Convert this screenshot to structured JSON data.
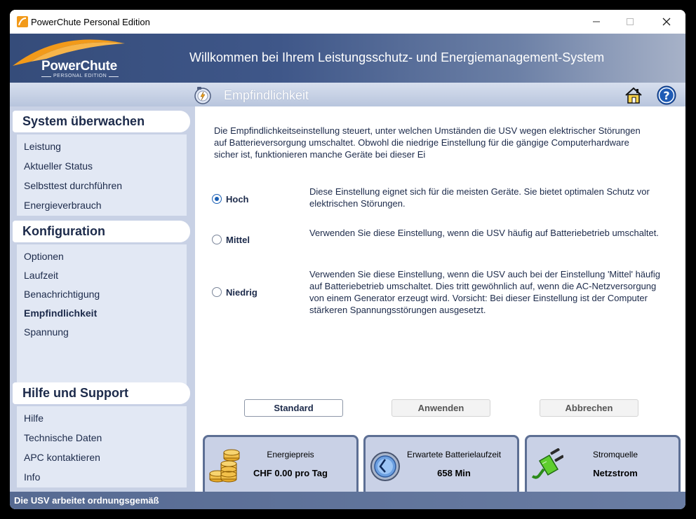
{
  "window": {
    "title": "PowerChute Personal Edition",
    "min_icon": "minimize-icon",
    "max_icon": "maximize-icon",
    "close_icon": "close-icon"
  },
  "header": {
    "logo_name": "PowerChute",
    "logo_sub": "PERSONAL EDITION",
    "title": "Willkommen bei Ihrem Leistungsschutz- und Energiemanagement-System"
  },
  "subheader": {
    "title": "Empfindlichkeit"
  },
  "sidebar": {
    "sections": [
      {
        "title": "System überwachen",
        "items": [
          "Leistung",
          "Aktueller Status",
          "Selbsttest durchführen",
          "Energieverbrauch"
        ]
      },
      {
        "title": "Konfiguration",
        "items": [
          "Optionen",
          "Laufzeit",
          "Benachrichtigung",
          "Empfindlichkeit",
          "Spannung"
        ]
      },
      {
        "title": "Hilfe und Support",
        "items": [
          "Hilfe",
          "Technische Daten",
          "APC kontaktieren",
          "Info"
        ]
      }
    ],
    "active_item": "Empfindlichkeit"
  },
  "content": {
    "intro": "Die Empfindlichkeitseinstellung steuert, unter welchen Umständen die USV wegen elektrischer Störungen auf Batterieversorgung umschaltet. Obwohl die niedrige Einstellung für die gängige Computerhardware sicher ist, funktionieren manche Geräte bei dieser Ei",
    "options": [
      {
        "label": "Hoch",
        "selected": true,
        "description": "Diese Einstellung eignet sich für die meisten Geräte. Sie bietet optimalen Schutz vor elektrischen Störungen."
      },
      {
        "label": "Mittel",
        "selected": false,
        "description": "Verwenden Sie diese Einstellung, wenn die USV häufig auf Batteriebetrieb umschaltet."
      },
      {
        "label": "Niedrig",
        "selected": false,
        "description": "Verwenden Sie diese Einstellung, wenn die USV auch bei der Einstellung 'Mittel' häufig auf Batteriebetrieb umschaltet. Dies tritt gewöhnlich auf, wenn die AC-Netzversorgung von einem Generator erzeugt wird. Vorsicht: Bei dieser Einstellung ist der Computer stärkeren Spannungsstörungen ausgesetzt."
      }
    ],
    "buttons": {
      "default": "Standard",
      "apply": "Anwenden",
      "cancel": "Abbrechen"
    }
  },
  "panels": [
    {
      "label": "Energiepreis",
      "value": "CHF 0.00 pro Tag",
      "icon": "coins-icon"
    },
    {
      "label": "Erwartete Batterielaufzeit",
      "value": "658 Min",
      "icon": "clock-icon"
    },
    {
      "label": "Stromquelle",
      "value": "Netzstrom",
      "icon": "plug-icon"
    }
  ],
  "status": {
    "text": "Die USV arbeitet ordnungsgemäß"
  },
  "colors": {
    "header_dark": "#354c7a",
    "sidebar_bg": "#c8d1e5",
    "accent_orange": "#f29a1a",
    "radio_blue": "#1a5fb4"
  }
}
